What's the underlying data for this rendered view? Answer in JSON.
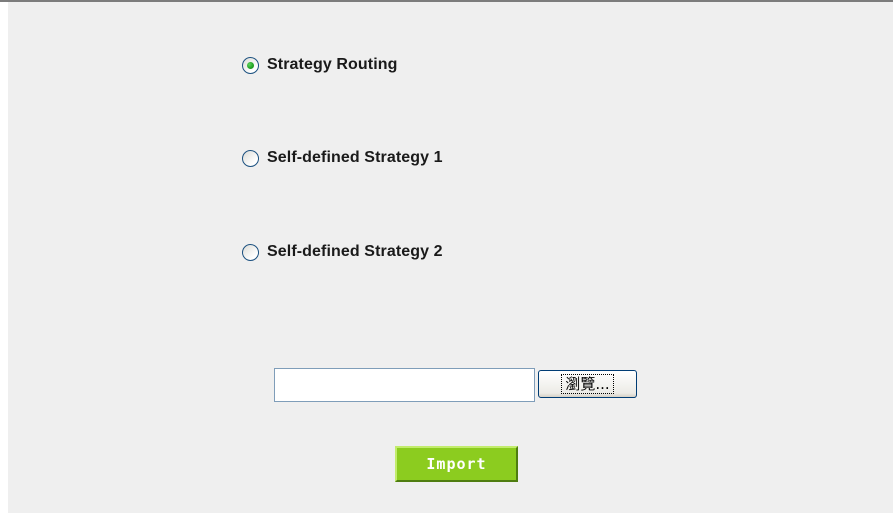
{
  "strategy_options": {
    "items": [
      {
        "label": "Strategy Routing",
        "selected": true
      },
      {
        "label": "Self-defined Strategy 1",
        "selected": false
      },
      {
        "label": "Self-defined Strategy 2",
        "selected": false
      }
    ]
  },
  "file_upload": {
    "value": "",
    "browse_label": "瀏覽..."
  },
  "import_button": {
    "label": "Import",
    "color": "#8ccc1f"
  },
  "colors": {
    "panel_background": "#efefef",
    "radio_selected_dot": "#21a121"
  }
}
